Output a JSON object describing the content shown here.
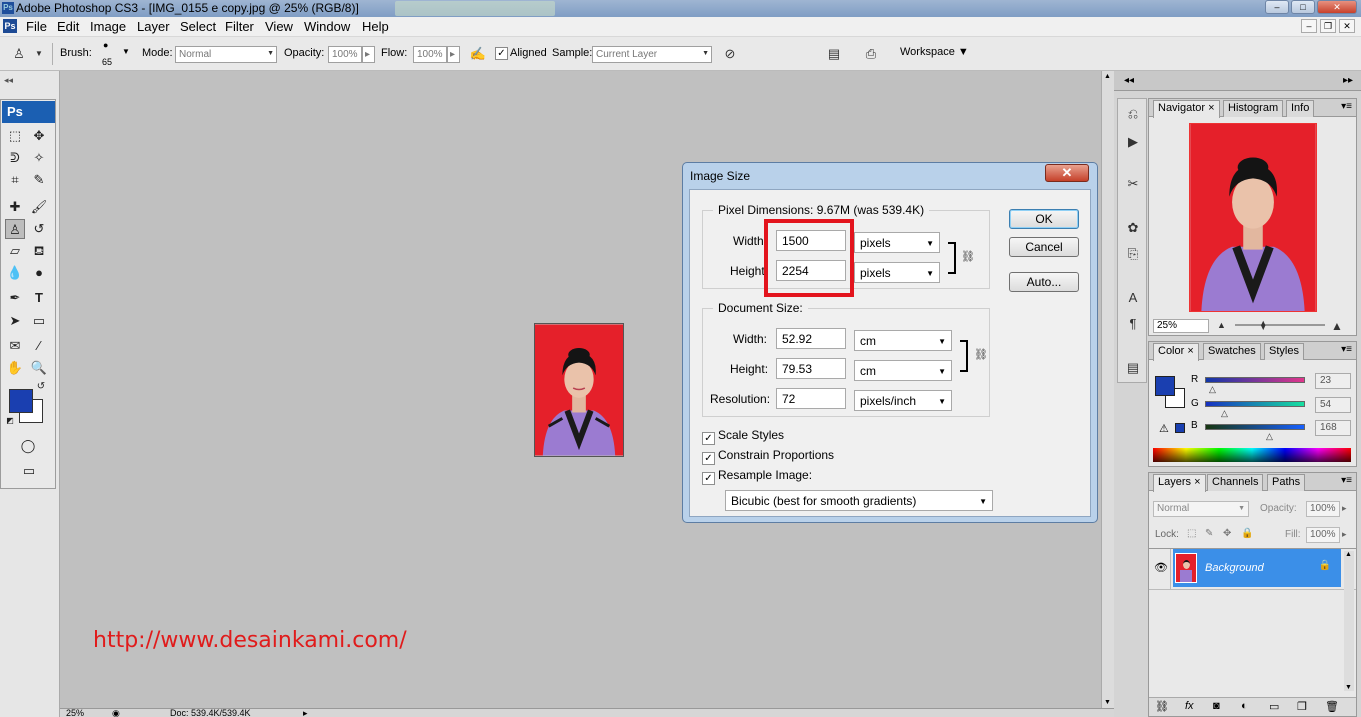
{
  "window": {
    "title": "Adobe Photoshop CS3 - [IMG_0155 e copy.jpg @ 25% (RGB/8)]",
    "controls": [
      "–",
      "□",
      "✕"
    ]
  },
  "menu": [
    "File",
    "Edit",
    "Image",
    "Layer",
    "Select",
    "Filter",
    "View",
    "Window",
    "Help"
  ],
  "options_bar": {
    "brush_label": "Brush:",
    "brush_size": "65",
    "mode_label": "Mode:",
    "mode_value": "Normal",
    "opacity_label": "Opacity:",
    "opacity_value": "100%",
    "flow_label": "Flow:",
    "flow_value": "100%",
    "aligned_label": "Aligned",
    "sample_label": "Sample:",
    "sample_value": "Current Layer",
    "workspace_label": "Workspace ▼"
  },
  "toolbox": {
    "logo": "Ps",
    "fg_color": "#1a3fb0",
    "bg_color": "#ffffff"
  },
  "canvas": {
    "url_text": "http://www.desainkami.com/"
  },
  "status": {
    "zoom": "25%",
    "doc": "Doc: 539.4K/539.4K"
  },
  "dialog": {
    "title": "Image Size",
    "close": "✕",
    "pixel_dimensions_label": "Pixel Dimensions:  9.67M (was 539.4K)",
    "pd_width_label": "Width:",
    "pd_width_value": "1500",
    "pd_width_unit": "pixels",
    "pd_height_label": "Height:",
    "pd_height_value": "2254",
    "pd_height_unit": "pixels",
    "document_size_label": "Document Size:",
    "ds_width_label": "Width:",
    "ds_width_value": "52.92",
    "ds_width_unit": "cm",
    "ds_height_label": "Height:",
    "ds_height_value": "79.53",
    "ds_height_unit": "cm",
    "resolution_label": "Resolution:",
    "resolution_value": "72",
    "resolution_unit": "pixels/inch",
    "scale_styles": "Scale Styles",
    "constrain_proportions": "Constrain Proportions",
    "resample_image": "Resample Image:",
    "resample_method": "Bicubic (best for smooth gradients)",
    "ok": "OK",
    "cancel": "Cancel",
    "auto": "Auto...",
    "highlight_color": "#e3141d"
  },
  "navigator_panel": {
    "tabs": [
      "Navigator",
      "Histogram",
      "Info"
    ],
    "zoom": "25%"
  },
  "color_panel": {
    "tabs": [
      "Color",
      "Swatches",
      "Styles"
    ],
    "r_label": "R",
    "g_label": "G",
    "b_label": "B",
    "r_value": "23",
    "g_value": "54",
    "b_value": "168",
    "r_level": 0.09,
    "g_level": 0.21,
    "b_level": 0.66
  },
  "layers_panel": {
    "tabs": [
      "Layers",
      "Channels",
      "Paths"
    ],
    "blend_mode": "Normal",
    "opacity_label": "Opacity:",
    "opacity_value": "100%",
    "lock_label": "Lock:",
    "fill_label": "Fill:",
    "fill_value": "100%",
    "layer_name": "Background"
  }
}
